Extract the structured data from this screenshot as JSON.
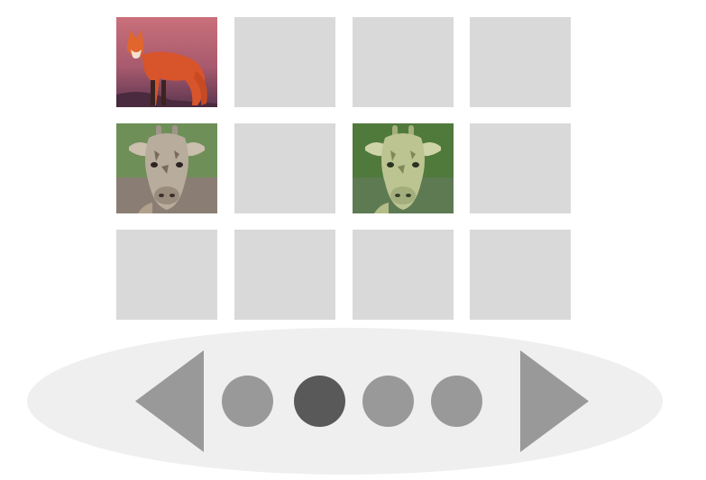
{
  "gallery": {
    "rows": [
      [
        {
          "name": "tile-fox",
          "content": "fox-photo"
        },
        {
          "name": "tile-empty",
          "content": "placeholder"
        },
        {
          "name": "tile-empty",
          "content": "placeholder"
        },
        {
          "name": "tile-empty",
          "content": "placeholder"
        }
      ],
      [
        {
          "name": "tile-giraffe",
          "content": "giraffe-photo"
        },
        {
          "name": "tile-empty",
          "content": "placeholder"
        },
        {
          "name": "tile-giraffe-green",
          "content": "giraffe-photo-green"
        },
        {
          "name": "tile-empty",
          "content": "placeholder"
        }
      ],
      [
        {
          "name": "tile-empty",
          "content": "placeholder"
        },
        {
          "name": "tile-empty",
          "content": "placeholder"
        },
        {
          "name": "tile-empty",
          "content": "placeholder"
        },
        {
          "name": "tile-empty",
          "content": "placeholder"
        }
      ]
    ]
  },
  "pager": {
    "prev_icon": "triangle-left-icon",
    "next_icon": "triangle-right-icon",
    "page_count": 4,
    "active_page": 2
  },
  "colors": {
    "tile_placeholder": "#d9d9d9",
    "pager_background": "#efefef",
    "arrow": "#999999",
    "dot_inactive": "#999999",
    "dot_active": "#595959"
  }
}
